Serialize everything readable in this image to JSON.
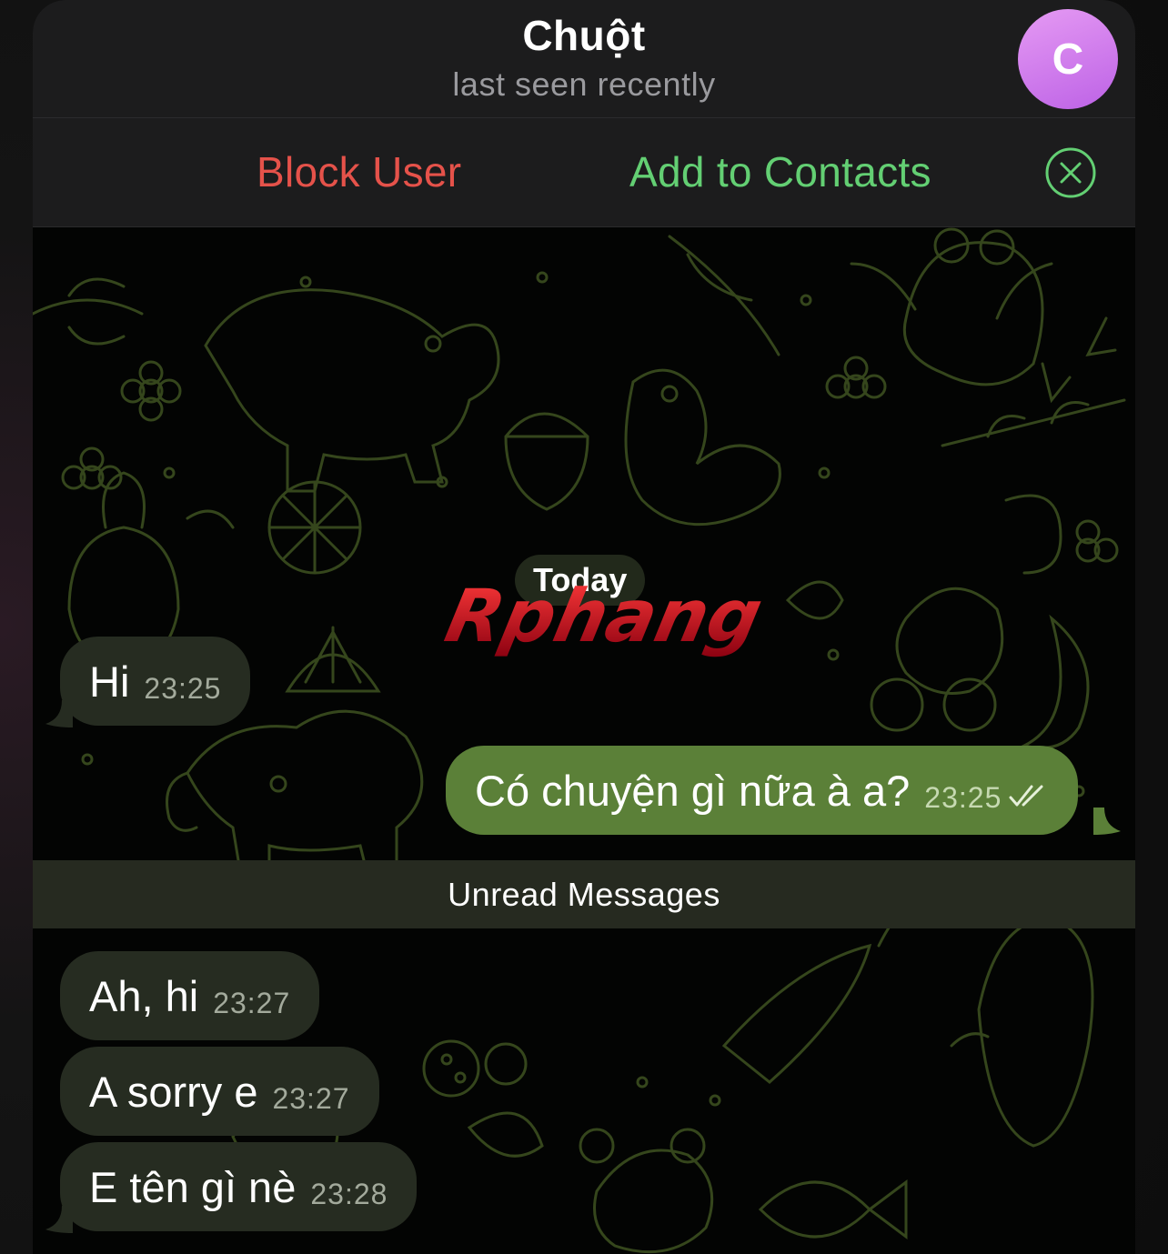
{
  "header": {
    "title": "Chuột",
    "subtitle": "last seen recently",
    "avatar_letter": "C"
  },
  "actions": {
    "block_label": "Block User",
    "add_label": "Add to Contacts"
  },
  "chat": {
    "date_label": "Today",
    "watermark": "Rphang",
    "unread_label": "Unread Messages",
    "messages": [
      {
        "text": "Hi",
        "time": "23:25",
        "direction": "incoming"
      },
      {
        "text": "Có chuyện gì nữa à a?",
        "time": "23:25",
        "direction": "outgoing",
        "status": "read"
      },
      {
        "text": "Ah, hi",
        "time": "23:27",
        "direction": "incoming"
      },
      {
        "text": "A sorry e",
        "time": "23:27",
        "direction": "incoming"
      },
      {
        "text": "E tên gì nè",
        "time": "23:28",
        "direction": "incoming"
      }
    ]
  },
  "colors": {
    "block": "#e5524a",
    "add": "#63cf73",
    "outgoing_bubble": "#5b8038",
    "incoming_bubble": "#262c21",
    "avatar_gradient": [
      "#e59af3",
      "#bd62e6"
    ]
  },
  "icons": {
    "close": "close-circle-icon",
    "read_status": "double-check-icon"
  }
}
